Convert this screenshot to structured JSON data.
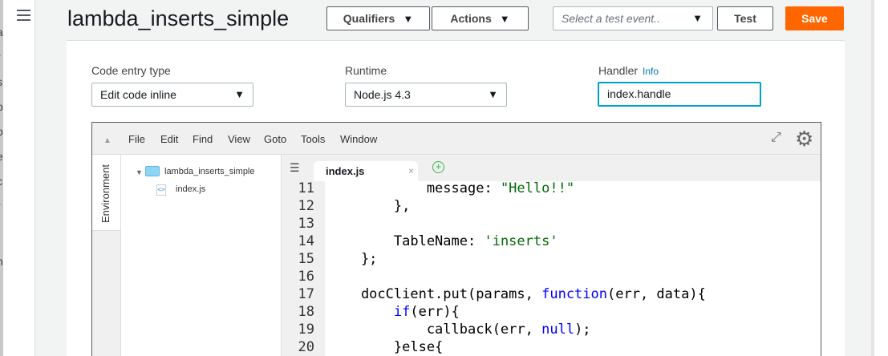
{
  "background_sidebar_fragments": [
    "a",
    "r",
    "s",
    "o",
    "o",
    "e",
    "c",
    "r",
    "n"
  ],
  "header": {
    "title": "lambda_inserts_simple",
    "qualifiers": "Qualifiers",
    "actions": "Actions",
    "test_event_placeholder": "Select a test event..",
    "test": "Test",
    "save": "Save",
    "save_color": "#ff6600"
  },
  "config": {
    "code_entry_label": "Code entry type",
    "code_entry_value": "Edit code inline",
    "runtime_label": "Runtime",
    "runtime_value": "Node.js 4.3",
    "handler_label": "Handler",
    "handler_info": "Info",
    "handler_value": "index.handle"
  },
  "ide": {
    "menu": [
      "File",
      "Edit",
      "Find",
      "View",
      "Goto",
      "Tools",
      "Window"
    ],
    "env_tab": "Environment",
    "folder": "lambda_inserts_simple",
    "file": "index.js",
    "tab": "index.js",
    "lines": [
      {
        "n": "11",
        "segs": [
          {
            "t": "            message: "
          },
          {
            "t": "\"Hello!!\"",
            "c": "str"
          }
        ]
      },
      {
        "n": "12",
        "segs": [
          {
            "t": "        },"
          }
        ]
      },
      {
        "n": "13",
        "segs": [
          {
            "t": ""
          }
        ]
      },
      {
        "n": "14",
        "segs": [
          {
            "t": "        TableName: "
          },
          {
            "t": "'inserts'",
            "c": "str"
          }
        ]
      },
      {
        "n": "15",
        "segs": [
          {
            "t": "    };"
          }
        ]
      },
      {
        "n": "16",
        "segs": [
          {
            "t": ""
          }
        ]
      },
      {
        "n": "17",
        "segs": [
          {
            "t": "    docClient.put(params, "
          },
          {
            "t": "function",
            "c": "kw"
          },
          {
            "t": "(err, data){"
          }
        ]
      },
      {
        "n": "18",
        "segs": [
          {
            "t": "        "
          },
          {
            "t": "if",
            "c": "kw"
          },
          {
            "t": "(err){"
          }
        ]
      },
      {
        "n": "19",
        "segs": [
          {
            "t": "            callback(err, "
          },
          {
            "t": "null",
            "c": "kw"
          },
          {
            "t": ");"
          }
        ]
      },
      {
        "n": "20",
        "segs": [
          {
            "t": "        }else{"
          }
        ]
      }
    ]
  }
}
